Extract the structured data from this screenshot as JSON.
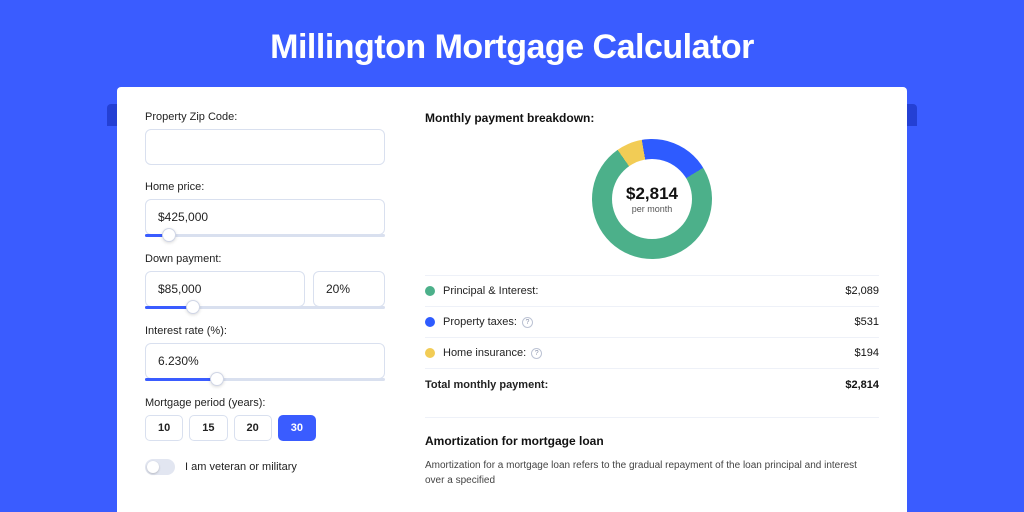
{
  "page_title": "Millington Mortgage Calculator",
  "colors": {
    "bg": "#3a5cff",
    "dark_stripe": "#2440d4",
    "green": "#4cb08a",
    "blue": "#2e5bff",
    "yellow": "#f2cc55"
  },
  "form": {
    "zip": {
      "label": "Property Zip Code:",
      "value": ""
    },
    "home_price": {
      "label": "Home price:",
      "value": "$425,000",
      "slider_pct": 10
    },
    "down_payment": {
      "label": "Down payment:",
      "amount": "$85,000",
      "percent": "20%",
      "slider_pct": 20
    },
    "interest_rate": {
      "label": "Interest rate (%):",
      "value": "6.230%",
      "slider_pct": 30
    },
    "period": {
      "label": "Mortgage period (years):",
      "options": [
        "10",
        "15",
        "20",
        "30"
      ],
      "active_index": 3
    },
    "veteran_toggle": {
      "label": "I am veteran or military",
      "on": false
    }
  },
  "breakdown": {
    "heading": "Monthly payment breakdown:",
    "donut": {
      "center_value": "$2,814",
      "center_sub": "per month",
      "segments": [
        {
          "color": "#4cb08a",
          "pct": 74
        },
        {
          "color": "#2e5bff",
          "pct": 19
        },
        {
          "color": "#f2cc55",
          "pct": 7
        }
      ]
    },
    "rows": [
      {
        "dot": "#4cb08a",
        "label": "Principal & Interest:",
        "info": false,
        "value": "$2,089"
      },
      {
        "dot": "#2e5bff",
        "label": "Property taxes:",
        "info": true,
        "value": "$531"
      },
      {
        "dot": "#f2cc55",
        "label": "Home insurance:",
        "info": true,
        "value": "$194"
      }
    ],
    "total": {
      "label": "Total monthly payment:",
      "value": "$2,814"
    }
  },
  "amortization": {
    "heading": "Amortization for mortgage loan",
    "text": "Amortization for a mortgage loan refers to the gradual repayment of the loan principal and interest over a specified"
  }
}
